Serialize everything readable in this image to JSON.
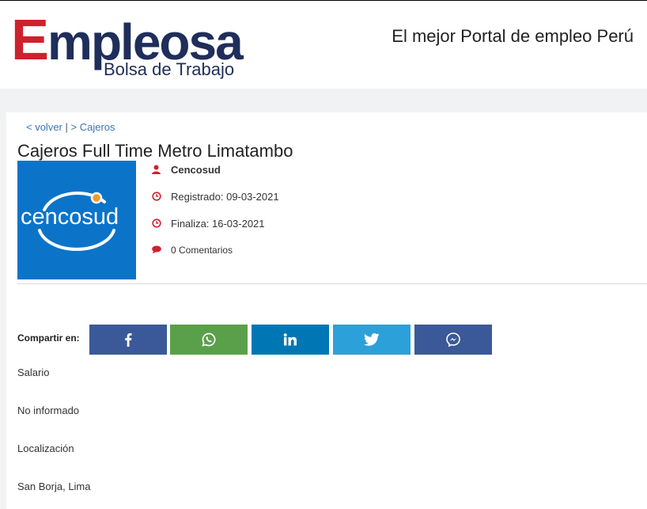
{
  "header": {
    "logo_main_first": "E",
    "logo_main_rest": "mpleosa",
    "logo_sub": "Bolsa de Trabajo",
    "tagline": "El mejor Portal de empleo Perú"
  },
  "breadcrumb": {
    "back": "< volver",
    "separator": " | ",
    "category": "> Cajeros"
  },
  "job": {
    "title": "Cajeros Full Time Metro Limatambo",
    "company_logo_text": "cencosud",
    "company": "Cencosud",
    "registered": "Registrado: 09-03-2021",
    "ends": "Finaliza: 16-03-2021",
    "comments": "0 Comentarios"
  },
  "share": {
    "label": "Compartir en:",
    "buttons": [
      {
        "name": "facebook",
        "color": "#3b5998"
      },
      {
        "name": "whatsapp",
        "color": "#5aa04a"
      },
      {
        "name": "linkedin",
        "color": "#0077b5"
      },
      {
        "name": "twitter",
        "color": "#2ca0d8"
      },
      {
        "name": "messenger",
        "color": "#3b5998"
      }
    ]
  },
  "details": {
    "salary_label": "Salario",
    "salary_value": "No informado",
    "location_label": "Localización",
    "location_value": "San Borja, Lima"
  },
  "colors": {
    "brand_red": "#d0202e",
    "brand_navy": "#1f2e5a",
    "link_blue": "#3a74b5",
    "icon_red": "#d0202e",
    "cencosud_blue": "#0b74c9"
  }
}
